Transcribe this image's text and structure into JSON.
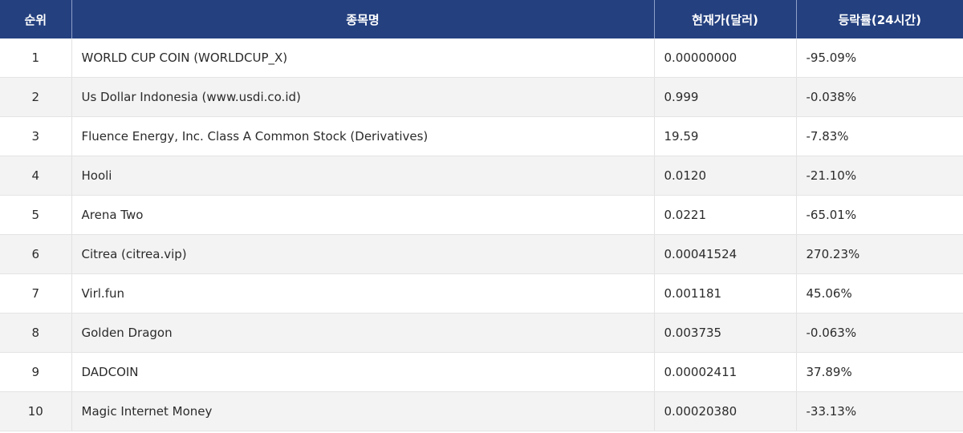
{
  "table": {
    "headers": {
      "rank": "순위",
      "name": "종목명",
      "price": "현재가(달러)",
      "change": "등락률(24시간)"
    },
    "rows": [
      {
        "rank": "1",
        "name": "WORLD CUP COIN (WORLDCUP_X)",
        "price": "0.00000000",
        "change": "-95.09%"
      },
      {
        "rank": "2",
        "name": "Us Dollar Indonesia (www.usdi.co.id)",
        "price": "0.999",
        "change": "-0.038%"
      },
      {
        "rank": "3",
        "name": "Fluence Energy, Inc. Class A Common Stock (Derivatives)",
        "price": "19.59",
        "change": "-7.83%"
      },
      {
        "rank": "4",
        "name": "Hooli",
        "price": "0.0120",
        "change": "-21.10%"
      },
      {
        "rank": "5",
        "name": "Arena Two",
        "price": "0.0221",
        "change": "-65.01%"
      },
      {
        "rank": "6",
        "name": "Citrea (citrea.vip)",
        "price": "0.00041524",
        "change": "270.23%"
      },
      {
        "rank": "7",
        "name": "Virl.fun",
        "price": "0.001181",
        "change": "45.06%"
      },
      {
        "rank": "8",
        "name": "Golden Dragon",
        "price": "0.003735",
        "change": "-0.063%"
      },
      {
        "rank": "9",
        "name": "DADCOIN",
        "price": "0.00002411",
        "change": "37.89%"
      },
      {
        "rank": "10",
        "name": "Magic Internet Money",
        "price": "0.00020380",
        "change": "-33.13%"
      }
    ]
  },
  "colors": {
    "header_bg": "#24407f",
    "header_text": "#ffffff",
    "row_alt_bg": "#f3f3f3"
  }
}
